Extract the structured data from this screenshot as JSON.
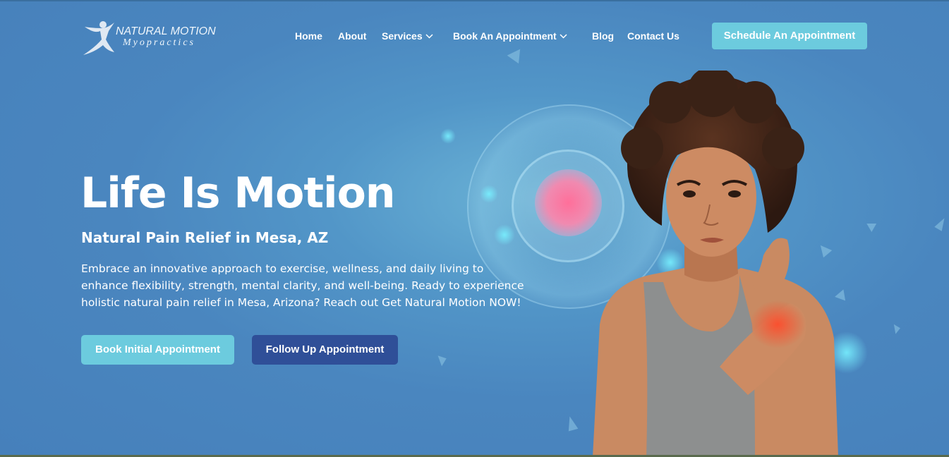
{
  "brand": {
    "name_line1": "NATURAL MOTION",
    "name_line2": "Myopractics"
  },
  "nav": {
    "items": [
      {
        "label": "Home",
        "has_dropdown": false
      },
      {
        "label": "About",
        "has_dropdown": false
      },
      {
        "label": "Services",
        "has_dropdown": true
      },
      {
        "label": "Book An Appointment",
        "has_dropdown": true
      },
      {
        "label": "Blog",
        "has_dropdown": false
      },
      {
        "label": "Contact Us",
        "has_dropdown": false
      }
    ],
    "cta_label": "Schedule An Appointment"
  },
  "hero": {
    "headline": "Life Is Motion",
    "subheadline": "Natural Pain Relief in Mesa, AZ",
    "body_line1": "Embrace an innovative approach to exercise, wellness, and daily living to",
    "body_line2": "enhance flexibility, strength, mental clarity, and well-being. Ready to experience",
    "body_line3": "holistic natural pain relief in Mesa, Arizona? Reach out Get Natural Motion NOW!",
    "primary_button": "Book Initial Appointment",
    "secondary_button": "Follow Up Appointment"
  },
  "colors": {
    "background": "#4a86bf",
    "accent_cyan": "#6ccbde",
    "accent_navy": "#2f4f98",
    "text": "#ffffff"
  }
}
